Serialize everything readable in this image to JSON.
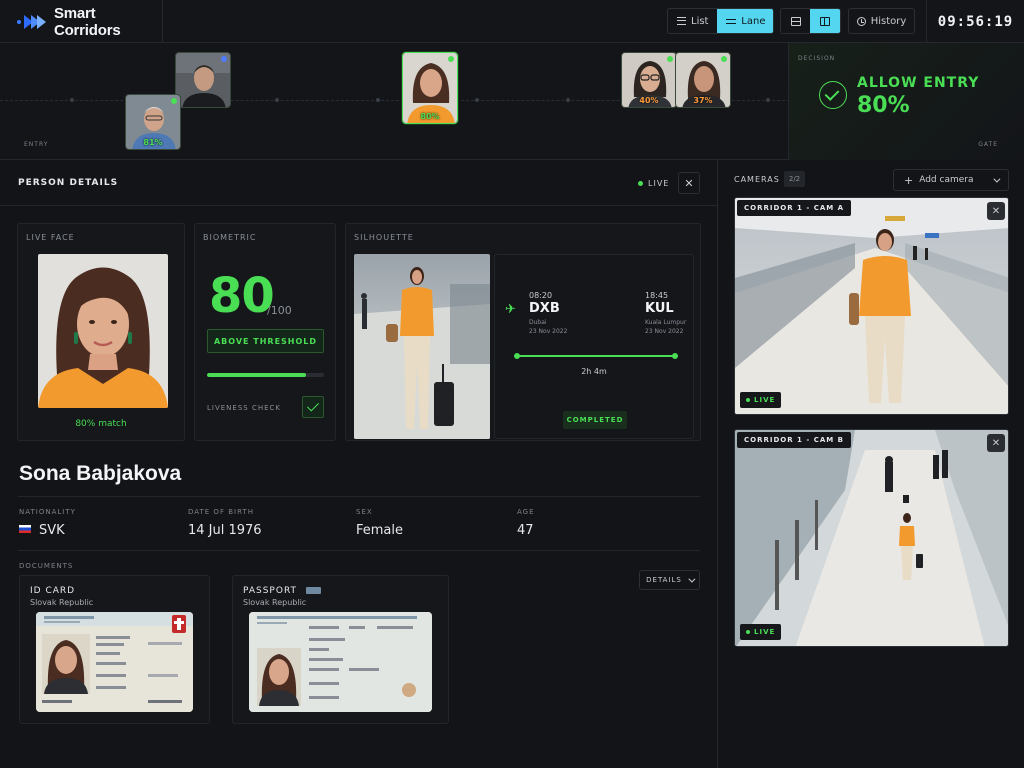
{
  "app": {
    "name": "Smart Corridors",
    "clock": "09:56:19"
  },
  "toolbar": {
    "view_list": "List",
    "view_lane": "Lane",
    "history": "History"
  },
  "lane": {
    "entry_label": "ENTRY",
    "faces": [
      {
        "pct": "81%"
      },
      {
        "pct": ""
      },
      {
        "pct": "80%"
      },
      {
        "pct": "40%"
      },
      {
        "pct": "37%"
      }
    ],
    "decision": {
      "label": "DECISION",
      "title": "ALLOW ENTRY",
      "pct": "80%",
      "gate": "GATE"
    }
  },
  "person": {
    "section_title": "PERSON DETAILS",
    "live": "LIVE",
    "live_face_label": "LIVE FACE",
    "match": "80% match",
    "biometric_label": "BIOMETRIC",
    "score": "80",
    "score_den": "/100",
    "score_fraction": 0.85,
    "threshold": "ABOVE THRESHOLD",
    "liveness": "LIVENESS CHECK",
    "silhouette_label": "SILHOUETTE",
    "flight": {
      "dep_time": "08:20",
      "dep_code": "DXB",
      "dep_city": "Dubai",
      "dep_date": "23 Nov 2022",
      "arr_time": "18:45",
      "arr_code": "KUL",
      "arr_city": "Kuala Lumpur",
      "arr_date": "23 Nov 2022",
      "duration": "2h 4m",
      "status": "COMPLETED"
    },
    "name": "Sona Babjakova",
    "attrs": {
      "nationality_label": "NATIONALITY",
      "nationality": "SVK",
      "dob_label": "DATE OF BIRTH",
      "dob": "14 Jul 1976",
      "sex_label": "SEX",
      "sex": "Female",
      "age_label": "AGE",
      "age": "47"
    },
    "documents_label": "DOCUMENTS",
    "details_btn": "DETAILS",
    "documents": [
      {
        "title": "ID CARD",
        "issuer": "Slovak Republic"
      },
      {
        "title": "PASSPORT",
        "issuer": "Slovak Republic"
      }
    ]
  },
  "cameras": {
    "title": "CAMERAS",
    "count": "2/2",
    "add": "Add camera",
    "list": [
      {
        "name": "CORRIDOR 1 - CAM A",
        "status": "LIVE"
      },
      {
        "name": "CORRIDOR 1 - CAM B",
        "status": "LIVE"
      }
    ]
  },
  "colors": {
    "accent": "#4ade54",
    "cyan": "#55d6f0",
    "warn": "#ff9a3c",
    "bg": "#121418"
  }
}
